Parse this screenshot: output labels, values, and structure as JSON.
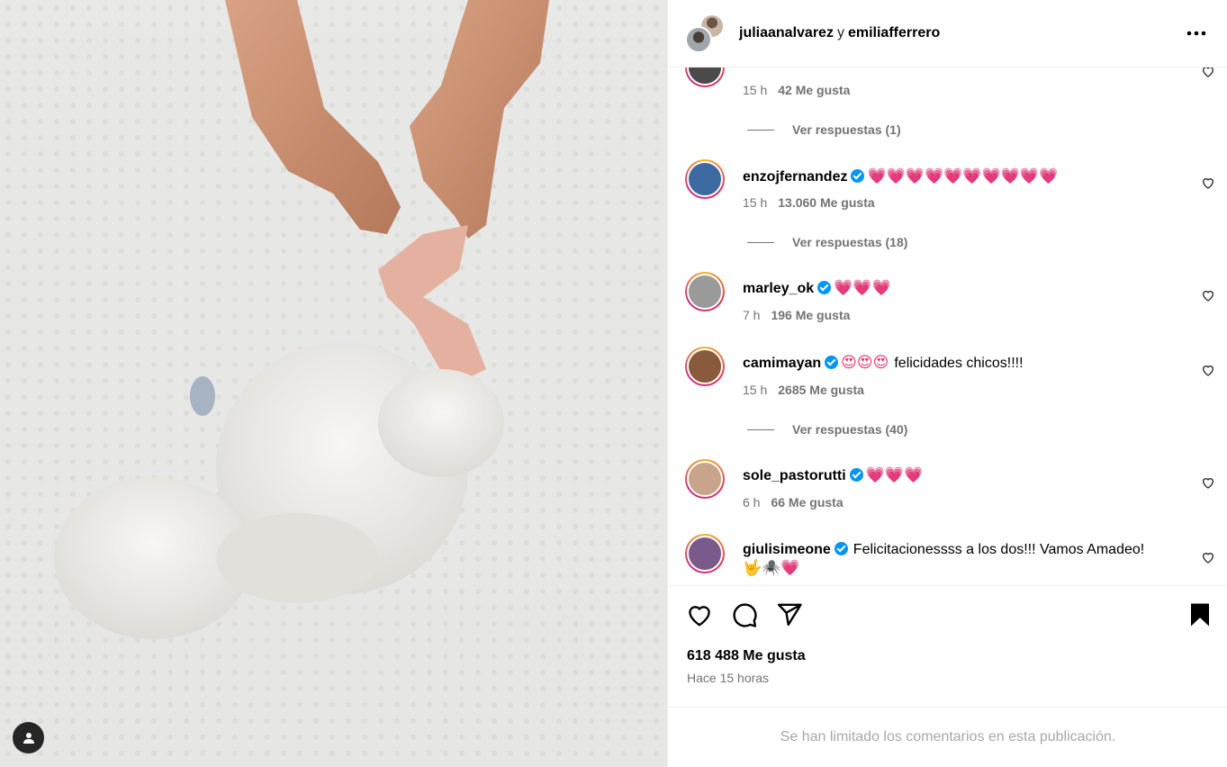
{
  "header": {
    "user1": "juliaanalvarez",
    "separator": "y",
    "user2": "emiliafferrero",
    "more_icon": "more-horizontal-icon"
  },
  "comments": [
    {
      "handle": "",
      "emojis": "",
      "text": "",
      "time": "15 h",
      "likes": "42 Me gusta",
      "replies": "Ver respuestas (1)",
      "avatar_color": "#4a4a4a"
    },
    {
      "handle": "enzojfernandez",
      "verified": true,
      "emojis": "💗💗💗💗💗💗💗💗💗💗",
      "text": "",
      "time": "15 h",
      "likes": "13.060 Me gusta",
      "replies": "Ver respuestas (18)",
      "avatar_color": "#3d6aa0"
    },
    {
      "handle": "marley_ok",
      "verified": true,
      "emojis": "💗💗💗",
      "text": "",
      "time": "7 h",
      "likes": "196 Me gusta",
      "replies": "",
      "avatar_color": "#9a9a9a"
    },
    {
      "handle": "camimayan",
      "verified": true,
      "emojis": "😍😍😍",
      "text": "felicidades chicos!!!!",
      "time": "15 h",
      "likes": "2685 Me gusta",
      "replies": "Ver respuestas (40)",
      "avatar_color": "#8a5a3c"
    },
    {
      "handle": "sole_pastorutti",
      "verified": true,
      "emojis": "💗💗💗",
      "text": "",
      "time": "6 h",
      "likes": "66 Me gusta",
      "replies": "",
      "avatar_color": "#c7a48a"
    },
    {
      "handle": "giulisimeone",
      "verified": true,
      "emojis": "",
      "text": "Felicitacionessss a los dos!!! Vamos Amadeo!",
      "line2": "🤟🕷️💗",
      "time": "",
      "likes": "",
      "replies": "",
      "avatar_color": "#7a5a8a"
    }
  ],
  "actions": {
    "like_icon": "heart-outline-icon",
    "comment_icon": "comment-bubble-icon",
    "share_icon": "paper-plane-icon",
    "save_icon": "bookmark-filled-icon",
    "likes_total": "618 488 Me gusta",
    "posted": "Hace 15 horas"
  },
  "footer": {
    "limited_text": "Se han limitado los comentarios en esta publicación."
  },
  "media": {
    "tag_icon": "user-tag-icon"
  }
}
